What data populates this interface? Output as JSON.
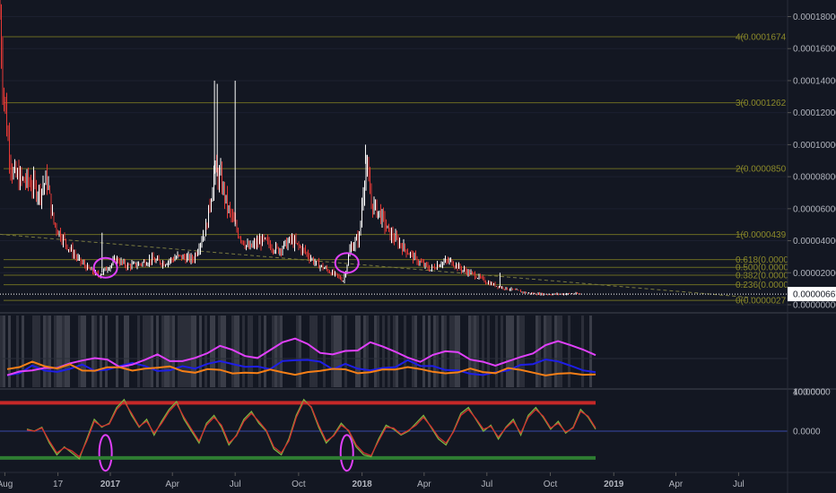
{
  "chart_data": [
    {
      "type": "candlestick",
      "panel": "price",
      "title": "",
      "y_ticks": [
        "0.00018000",
        "0.00016000",
        "0.00014000",
        "0.00012000",
        "0.00010000",
        "0.00008000",
        "0.00006000",
        "0.00004000",
        "0.00002000",
        "0.00000000"
      ],
      "ylim": [
        0,
        0.000187
      ],
      "current_price": "0.00000667",
      "current_price_value": 6.67e-06,
      "fib_levels": [
        {
          "label": "4(0.0001674",
          "value": 0.0001674
        },
        {
          "label": "3(0.0001262",
          "value": 0.0001262
        },
        {
          "label": "2(0.0000850",
          "value": 8.5e-05
        },
        {
          "label": "1(0.0000439",
          "value": 4.39e-05
        },
        {
          "label": "0.618(0.0000",
          "value": 2.82e-05
        },
        {
          "label": "0.500(0.0000",
          "value": 2.34e-05
        },
        {
          "label": "0.382(0.0000",
          "value": 1.85e-05
        },
        {
          "label": "0.236(0.0000",
          "value": 1.25e-05
        },
        {
          "label": "0(0.0000027",
          "value": 2.7e-06
        }
      ],
      "price_points": [
        {
          "x": "2016-07-25",
          "y": 0.00018
        },
        {
          "x": "2016-07-29",
          "y": 0.00014
        },
        {
          "x": "2016-08-05",
          "y": 0.000105
        },
        {
          "x": "2016-08-12",
          "y": 8.2e-05
        },
        {
          "x": "2016-08-22",
          "y": 7.8e-05
        },
        {
          "x": "2016-09-05",
          "y": 7.6e-05
        },
        {
          "x": "2016-09-20",
          "y": 7e-05
        },
        {
          "x": "2016-10-01",
          "y": 7.8e-05
        },
        {
          "x": "2016-10-10",
          "y": 5.2e-05
        },
        {
          "x": "2016-10-20",
          "y": 4.4e-05
        },
        {
          "x": "2016-11-01",
          "y": 3.6e-05
        },
        {
          "x": "2016-11-15",
          "y": 2.8e-05
        },
        {
          "x": "2016-12-01",
          "y": 2.2e-05
        },
        {
          "x": "2016-12-15",
          "y": 1.8e-05
        },
        {
          "x": "2016-12-25",
          "y": 2.2e-05
        },
        {
          "x": "2017-01-10",
          "y": 2.8e-05
        },
        {
          "x": "2017-01-25",
          "y": 2.4e-05
        },
        {
          "x": "2017-02-10",
          "y": 2.5e-05
        },
        {
          "x": "2017-03-01",
          "y": 2.8e-05
        },
        {
          "x": "2017-03-20",
          "y": 2.6e-05
        },
        {
          "x": "2017-04-10",
          "y": 3e-05
        },
        {
          "x": "2017-05-01",
          "y": 2.8e-05
        },
        {
          "x": "2017-05-20",
          "y": 4.8e-05
        },
        {
          "x": "2017-06-01",
          "y": 8.2e-05
        },
        {
          "x": "2017-06-10",
          "y": 7.8e-05
        },
        {
          "x": "2017-06-20",
          "y": 6e-05
        },
        {
          "x": "2017-07-05",
          "y": 4.5e-05
        },
        {
          "x": "2017-07-20",
          "y": 3.5e-05
        },
        {
          "x": "2017-08-10",
          "y": 4e-05
        },
        {
          "x": "2017-09-01",
          "y": 3.4e-05
        },
        {
          "x": "2017-09-20",
          "y": 4e-05
        },
        {
          "x": "2017-10-10",
          "y": 3.3e-05
        },
        {
          "x": "2017-10-25",
          "y": 2.6e-05
        },
        {
          "x": "2017-11-10",
          "y": 2.2e-05
        },
        {
          "x": "2017-11-25",
          "y": 1.8e-05
        },
        {
          "x": "2017-12-05",
          "y": 1.5e-05
        },
        {
          "x": "2017-12-15",
          "y": 3.5e-05
        },
        {
          "x": "2017-12-28",
          "y": 4.2e-05
        },
        {
          "x": "2018-01-06",
          "y": 8.8e-05
        },
        {
          "x": "2018-01-15",
          "y": 6.2e-05
        },
        {
          "x": "2018-01-25",
          "y": 5.8e-05
        },
        {
          "x": "2018-02-10",
          "y": 4.4e-05
        },
        {
          "x": "2018-03-01",
          "y": 3.6e-05
        },
        {
          "x": "2018-03-20",
          "y": 2.8e-05
        },
        {
          "x": "2018-04-10",
          "y": 2.2e-05
        },
        {
          "x": "2018-04-25",
          "y": 2.6e-05
        },
        {
          "x": "2018-05-10",
          "y": 2.7e-05
        },
        {
          "x": "2018-05-25",
          "y": 2.2e-05
        },
        {
          "x": "2018-06-15",
          "y": 1.8e-05
        },
        {
          "x": "2018-07-01",
          "y": 1.4e-05
        },
        {
          "x": "2018-07-20",
          "y": 1.1e-05
        },
        {
          "x": "2018-08-10",
          "y": 9e-06
        },
        {
          "x": "2018-09-01",
          "y": 7e-06
        },
        {
          "x": "2018-10-01",
          "y": 6.5e-06
        },
        {
          "x": "2018-11-01",
          "y": 6.8e-06
        },
        {
          "x": "2018-11-15",
          "y": 6.7e-06
        }
      ],
      "spikes": [
        {
          "x": "2016-12-20",
          "y": 4.5e-05
        },
        {
          "x": "2017-06-01",
          "y": 0.00014
        },
        {
          "x": "2017-06-05",
          "y": 0.000138
        },
        {
          "x": "2017-07-01",
          "y": 0.00014
        },
        {
          "x": "2018-01-06",
          "y": 0.0001
        },
        {
          "x": "2018-07-20",
          "y": 2e-05
        }
      ],
      "trendline": [
        {
          "x": "2016-07-25",
          "y": 4.4e-05
        },
        {
          "x": "2019-07-20",
          "y": 4.5e-06
        }
      ],
      "highlight_circles": [
        "2016-12-25",
        "2017-12-10"
      ],
      "x_ticks": [
        "Aug",
        "17",
        "2017",
        "Apr",
        "Jul",
        "Oct",
        "2018",
        "Apr",
        "Jul",
        "Oct",
        "2019",
        "Apr",
        "Jul"
      ],
      "x_tick_dates": [
        "2016-08-01",
        "2016-10-17",
        "2017-01-01",
        "2017-04-01",
        "2017-07-01",
        "2017-10-01",
        "2018-01-01",
        "2018-04-01",
        "2018-07-01",
        "2018-10-01",
        "2019-01-01",
        "2019-04-01",
        "2019-07-01"
      ],
      "x_range": [
        "2016-07-25",
        "2019-09-10"
      ],
      "up_color": "#ffffff",
      "down_color": "#e53935"
    },
    {
      "type": "line",
      "panel": "indicator-1",
      "y_ticks": [
        "40.0000",
        "100.0000"
      ],
      "ylim": [
        0,
        100
      ],
      "series": [
        {
          "color": "#1e1ee6",
          "values": [
            18,
            22,
            28,
            24,
            20,
            26,
            30,
            25,
            22,
            27,
            32,
            28,
            24,
            26,
            30,
            28,
            33,
            38,
            35,
            30,
            28,
            26,
            34,
            40,
            38,
            33,
            28,
            30,
            25,
            22,
            24,
            28,
            36,
            32,
            27,
            24,
            22,
            20,
            18,
            22,
            26,
            30,
            34,
            38,
            33,
            28,
            24,
            20
          ]
        },
        {
          "color": "#e040fb",
          "values": [
            16,
            20,
            26,
            30,
            28,
            32,
            38,
            42,
            36,
            30,
            34,
            40,
            44,
            38,
            34,
            40,
            50,
            58,
            54,
            46,
            42,
            50,
            62,
            66,
            58,
            50,
            46,
            48,
            54,
            62,
            58,
            48,
            40,
            36,
            44,
            52,
            48,
            40,
            36,
            30,
            34,
            40,
            48,
            56,
            62,
            58,
            50,
            42
          ]
        },
        {
          "color": "#f57f17",
          "values": [
            24,
            30,
            36,
            32,
            28,
            30,
            26,
            24,
            28,
            30,
            26,
            24,
            26,
            28,
            24,
            22,
            24,
            26,
            22,
            20,
            22,
            24,
            20,
            18,
            22,
            24,
            26,
            24,
            22,
            20,
            22,
            26,
            28,
            24,
            22,
            20,
            22,
            24,
            20,
            22,
            24,
            22,
            20,
            18,
            20,
            22,
            20,
            18
          ]
        }
      ]
    },
    {
      "type": "line",
      "panel": "indicator-2",
      "y_ticks": [
        "0.0000"
      ],
      "ylim": [
        -1,
        1
      ],
      "upper_band": 0.72,
      "lower_band": -0.68,
      "series": [
        {
          "color": "#7cb342",
          "values": [
            0.05,
            0.0,
            0.1,
            -0.3,
            -0.6,
            -0.4,
            -0.55,
            -0.7,
            -0.2,
            0.3,
            0.1,
            0.2,
            0.6,
            0.8,
            0.4,
            0.1,
            0.3,
            -0.1,
            0.25,
            0.55,
            0.75,
            0.3,
            0.0,
            -0.3,
            0.2,
            0.4,
            0.1,
            -0.35,
            -0.1,
            0.3,
            0.5,
            0.2,
            0.0,
            -0.45,
            -0.6,
            -0.2,
            0.4,
            0.8,
            0.6,
            0.1,
            -0.3,
            -0.1,
            0.2,
            0.0,
            -0.4,
            -0.6,
            -0.65,
            -0.2,
            0.15,
            0.05,
            -0.1,
            0.0,
            0.2,
            0.4,
            0.1,
            -0.2,
            -0.35,
            0.0,
            0.45,
            0.6,
            0.3,
            0.0,
            0.15,
            -0.2,
            0.1,
            0.3,
            -0.1,
            0.4,
            0.6,
            0.35,
            0.05,
            0.25,
            -0.05,
            0.1,
            0.55,
            0.35,
            0.05
          ]
        },
        {
          "color": "#d32f2f",
          "values": [
            0.03,
            0.0,
            0.08,
            -0.25,
            -0.55,
            -0.42,
            -0.5,
            -0.65,
            -0.25,
            0.25,
            0.12,
            0.18,
            0.55,
            0.75,
            0.45,
            0.12,
            0.25,
            -0.05,
            0.2,
            0.5,
            0.7,
            0.35,
            0.05,
            -0.25,
            0.15,
            0.35,
            0.15,
            -0.3,
            -0.12,
            0.25,
            0.45,
            0.25,
            0.02,
            -0.4,
            -0.55,
            -0.25,
            0.35,
            0.75,
            0.62,
            0.15,
            -0.25,
            -0.12,
            0.15,
            0.02,
            -0.35,
            -0.55,
            -0.62,
            -0.25,
            0.1,
            0.08,
            -0.08,
            0.02,
            0.15,
            0.35,
            0.12,
            -0.15,
            -0.3,
            -0.02,
            0.4,
            0.55,
            0.32,
            0.05,
            0.12,
            -0.15,
            0.08,
            0.25,
            -0.05,
            0.35,
            0.55,
            0.38,
            0.08,
            0.2,
            -0.02,
            0.08,
            0.5,
            0.38,
            0.08
          ]
        }
      ]
    }
  ]
}
